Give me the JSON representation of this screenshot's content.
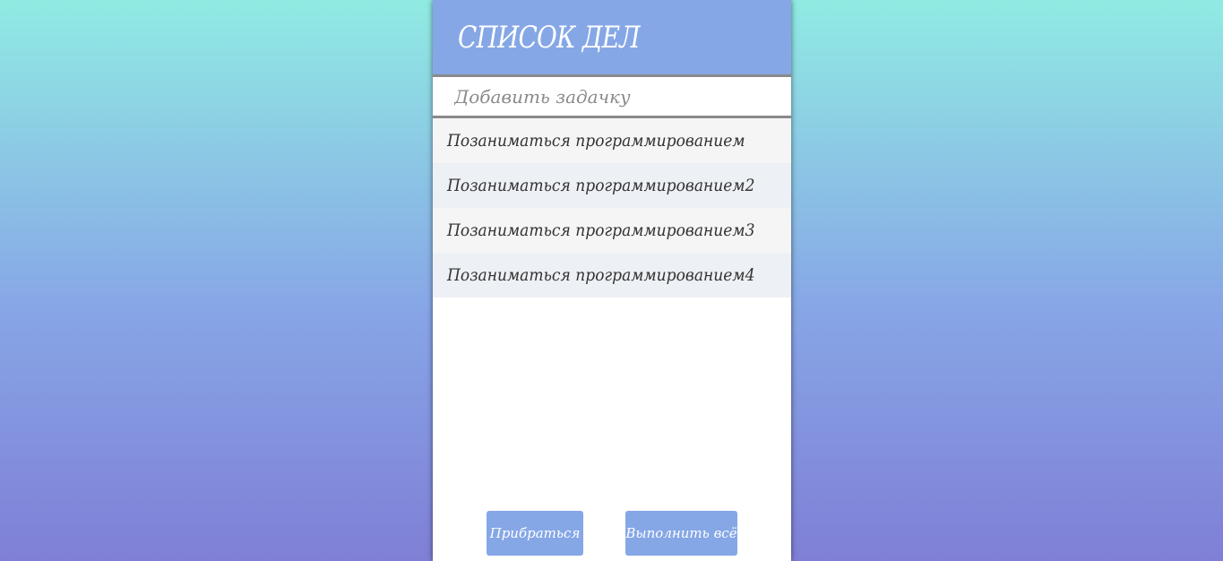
{
  "header": {
    "title": "СПИСОК ДЕЛ"
  },
  "new_task": {
    "placeholder": "Добавить задачку",
    "value": ""
  },
  "tasks": [
    {
      "label": "Позаниматься программированием"
    },
    {
      "label": "Позаниматься программированием2"
    },
    {
      "label": "Позаниматься программированием3"
    },
    {
      "label": "Позаниматься программированием4"
    }
  ],
  "footer": {
    "clean_label": "Прибраться",
    "complete_all_label": "Выполнить всё"
  },
  "colors": {
    "accent": "#86a7e6",
    "bg_top": "#90ebe3",
    "bg_bottom": "#7f7fd6"
  }
}
